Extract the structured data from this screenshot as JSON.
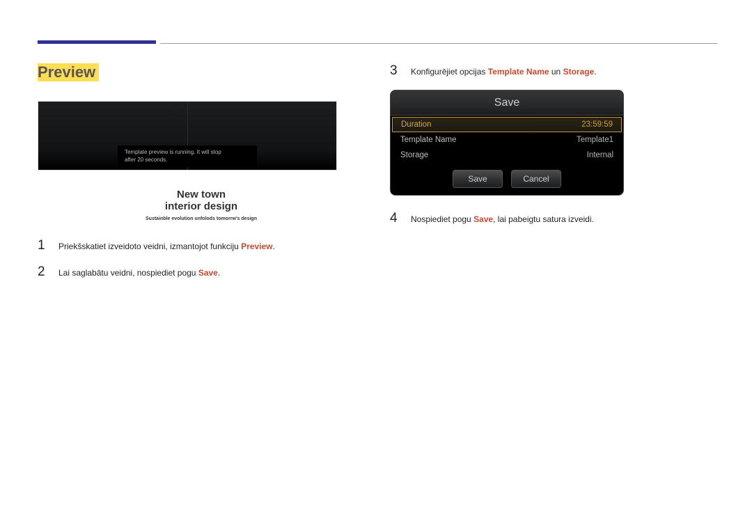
{
  "heading": "Preview",
  "preview": {
    "running_msg_line1": "Template preview is running. It will stop",
    "running_msg_line2": "after 20 seconds.",
    "caption_line1": "New town",
    "caption_line2": "interior design",
    "subcaption": "Sustainble evolution unfolods tomorrw's design"
  },
  "steps_left": [
    {
      "num": "1",
      "prefix": "Priekšskatiet izveidoto veidni, izmantojot funkciju ",
      "hl": "Preview",
      "suffix": "."
    },
    {
      "num": "2",
      "prefix": "Lai saglabātu veidni, nospiediet pogu ",
      "hl": "Save",
      "suffix": "."
    }
  ],
  "steps_right": {
    "s3": {
      "num": "3",
      "prefix": "Konfigurējiet opcijas ",
      "hl1": "Template Name",
      "mid": " un ",
      "hl2": "Storage",
      "suffix": "."
    },
    "s4": {
      "num": "4",
      "prefix": "Nospiediet pogu ",
      "hl": "Save",
      "suffix": ", lai pabeigtu satura izveidi."
    }
  },
  "dialog": {
    "title": "Save",
    "rows": [
      {
        "label": "Duration",
        "value": "23:59:59",
        "selected": true
      },
      {
        "label": "Template Name",
        "value": "Template1",
        "selected": false
      },
      {
        "label": "Storage",
        "value": "Internal",
        "selected": false
      }
    ],
    "save_btn": "Save",
    "cancel_btn": "Cancel"
  }
}
